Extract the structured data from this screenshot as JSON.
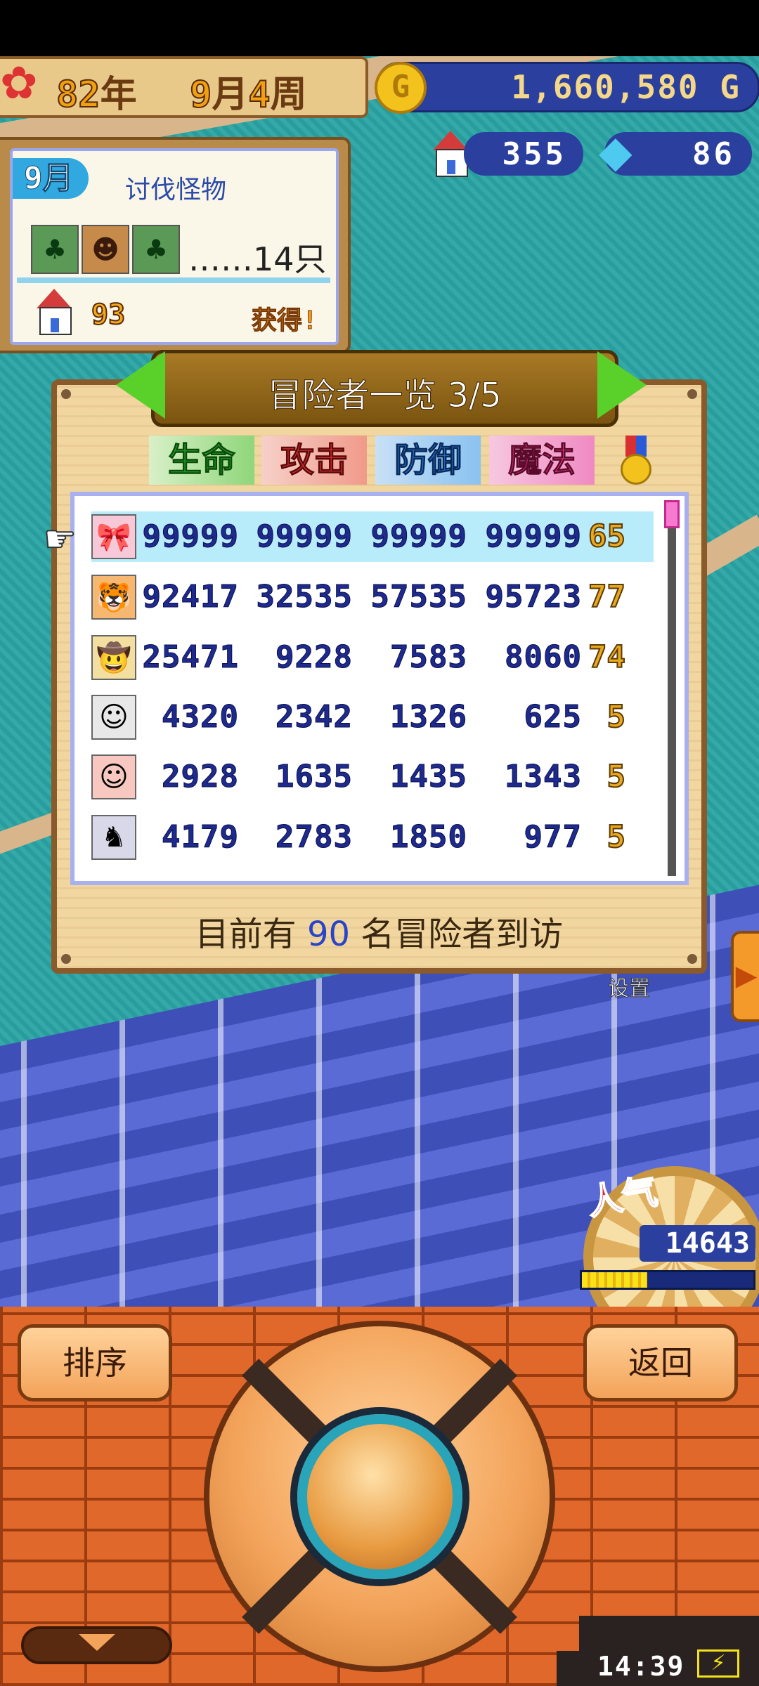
{
  "top_bar": {
    "year_num": "82",
    "year_unit": "年",
    "month_num": "9",
    "month_unit": "月",
    "week_num": "4",
    "week_unit": "周",
    "money": "1,660,580",
    "money_unit": "G",
    "coin_symbol": "G",
    "houses": "355",
    "crystals": "86"
  },
  "quest": {
    "month": "9月",
    "title": "讨伐怪物",
    "count": "……14只",
    "reward_amount": "93",
    "reward_label": "获得!"
  },
  "panel": {
    "title": "冒险者一览 3/5",
    "columns": [
      "生命",
      "攻击",
      "防御",
      "魔法"
    ],
    "rows": [
      {
        "hp": "99999",
        "atk": "99999",
        "def": "99999",
        "mag": "99999",
        "lvl": "65",
        "selected": true
      },
      {
        "hp": "92417",
        "atk": "32535",
        "def": "57535",
        "mag": "95723",
        "lvl": "77",
        "selected": false
      },
      {
        "hp": "25471",
        "atk": "9228",
        "def": "7583",
        "mag": "8060",
        "lvl": "74",
        "selected": false
      },
      {
        "hp": "4320",
        "atk": "2342",
        "def": "1326",
        "mag": "625",
        "lvl": "5",
        "selected": false
      },
      {
        "hp": "2928",
        "atk": "1635",
        "def": "1435",
        "mag": "1343",
        "lvl": "5",
        "selected": false
      },
      {
        "hp": "4179",
        "atk": "2783",
        "def": "1850",
        "mag": "977",
        "lvl": "5",
        "selected": false
      }
    ],
    "footer_prefix": "目前有",
    "footer_count": "90",
    "footer_suffix": "名冒险者到访"
  },
  "side": {
    "settings_label": "设置"
  },
  "popularity": {
    "label": "人气",
    "value": "14643",
    "fill_fraction": 0.38
  },
  "controls": {
    "sort_label": "排序",
    "back_label": "返回"
  },
  "status": {
    "time": "14:39",
    "battery_symbol": "⚡"
  },
  "colors": {
    "map_water": "#2aa3a3",
    "panel_wood": "#f2d6a0",
    "selected_row": "#b9ecfa",
    "stat_text": "#1e2a8c",
    "level_text": "#e9a91e"
  }
}
